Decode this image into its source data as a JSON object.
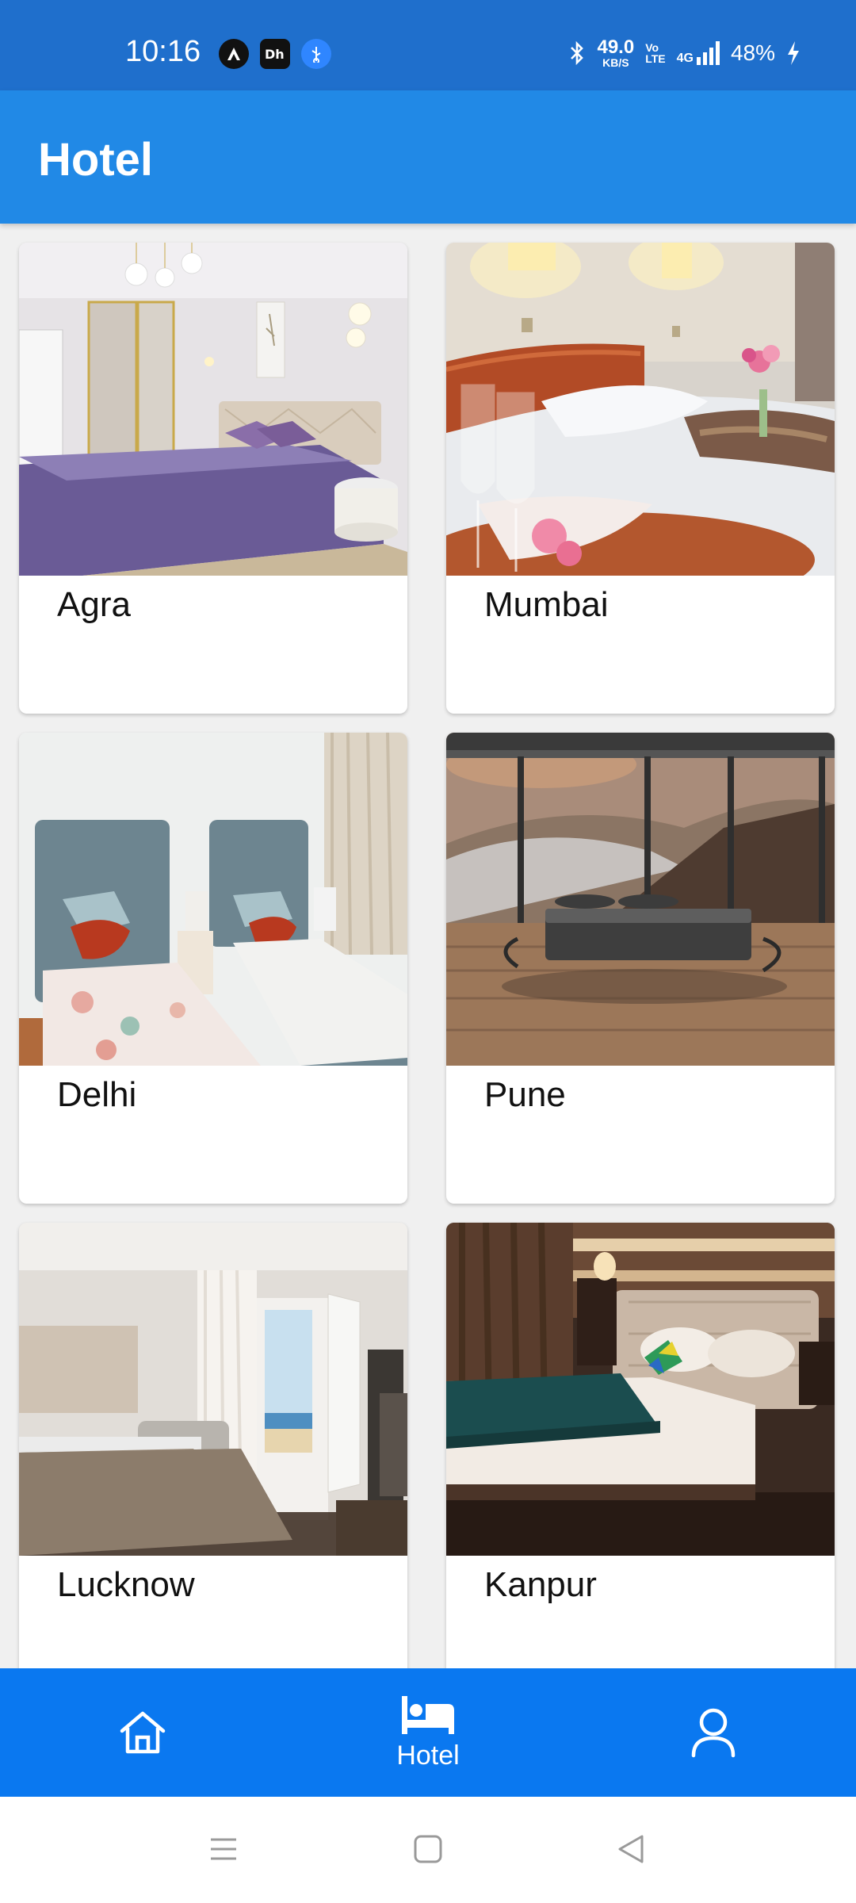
{
  "status_bar": {
    "time": "10:16",
    "net_speed_value": "49.0",
    "net_speed_unit": "KB/S",
    "volte_top": "Vo",
    "volte_bottom": "LTE",
    "network": "4G",
    "battery": "48%",
    "app_icons": [
      "arrow-up-icon",
      "dh-app-icon",
      "usb-icon"
    ]
  },
  "app_bar": {
    "title": "Hotel"
  },
  "cities": [
    {
      "name": "Agra",
      "image": "purple-bedroom"
    },
    {
      "name": "Mumbai",
      "image": "hotel-bed-wine-glasses"
    },
    {
      "name": "Delhi",
      "image": "twin-beds-red-pillows"
    },
    {
      "name": "Pune",
      "image": "floating-bed-mountain-view"
    },
    {
      "name": "Lucknow",
      "image": "bedroom-balcony-sea-view"
    },
    {
      "name": "Kanpur",
      "image": "dark-wood-hotel-bed"
    }
  ],
  "bottom_nav": {
    "items": [
      {
        "icon": "home-icon",
        "label": ""
      },
      {
        "icon": "bed-icon",
        "label": "Hotel"
      },
      {
        "icon": "person-icon",
        "label": ""
      }
    ],
    "active": "Hotel"
  },
  "colors": {
    "status_bar": "#1f6fcc",
    "app_bar": "#2189e6",
    "bottom_nav": "#0a78f0"
  }
}
